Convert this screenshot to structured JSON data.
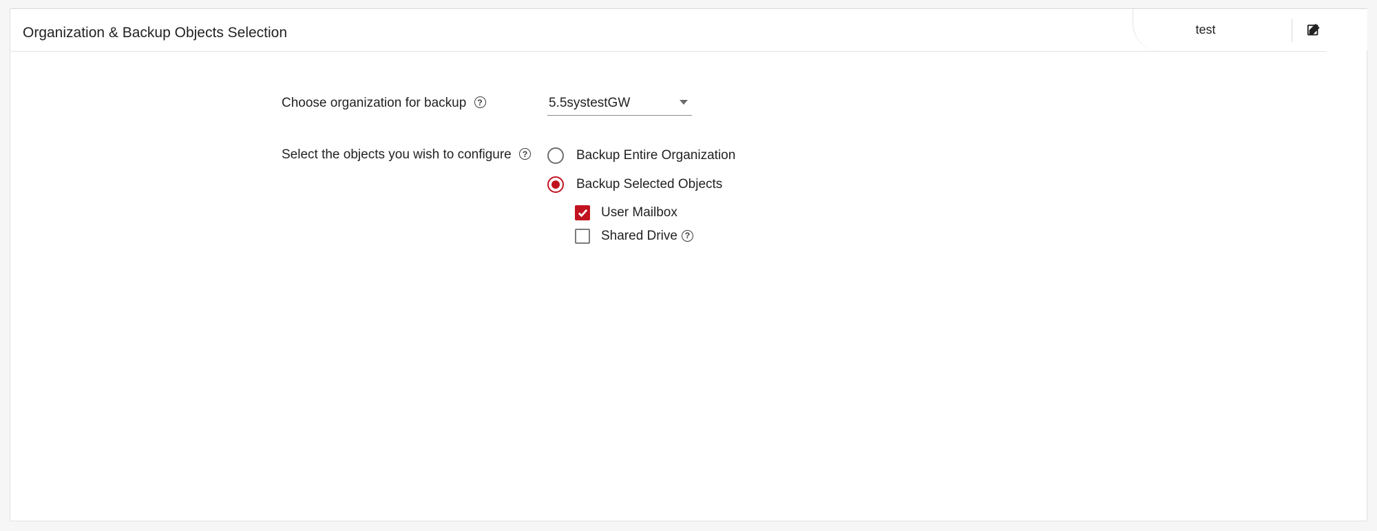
{
  "header": {
    "title": "Organization & Backup Objects Selection",
    "tab_label": "test"
  },
  "form": {
    "org_label": "Choose organization for backup",
    "org_selected": "5.5systestGW",
    "objects_label": "Select the objects you wish to configure",
    "radios": [
      {
        "label": "Backup Entire Organization",
        "selected": false
      },
      {
        "label": "Backup Selected Objects",
        "selected": true
      }
    ],
    "checkboxes": [
      {
        "label": "User Mailbox",
        "checked": true,
        "has_help": false
      },
      {
        "label": "Shared Drive",
        "checked": false,
        "has_help": true
      }
    ]
  },
  "colors": {
    "accent": "#c1121f"
  }
}
